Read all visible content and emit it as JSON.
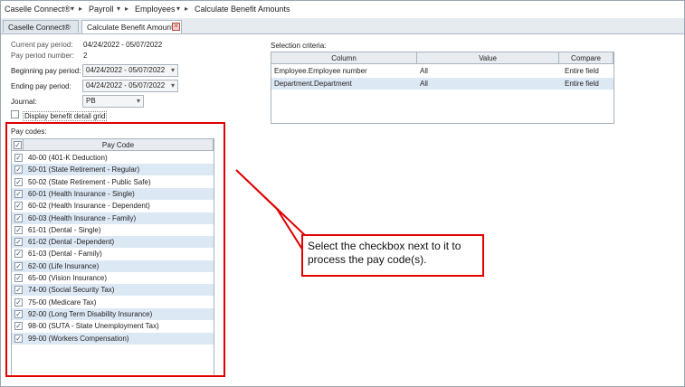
{
  "breadcrumb": [
    "Caselle Connect®",
    "Payroll",
    "Employees",
    "Calculate Benefit Amounts"
  ],
  "tabs": [
    {
      "label": "Caselle Connect®"
    },
    {
      "label": "Calculate Benefit Amounts"
    }
  ],
  "form": {
    "current_pay_period_label": "Current pay period:",
    "current_pay_period_value": "04/24/2022 - 05/07/2022",
    "pay_period_number_label": "Pay period number:",
    "pay_period_number_value": "2",
    "beginning_pay_period_label": "Beginning pay period:",
    "beginning_pay_period_value": "04/24/2022 - 05/07/2022",
    "ending_pay_period_label": "Ending pay period:",
    "ending_pay_period_value": "04/24/2022 - 05/07/2022",
    "journal_label": "Journal:",
    "journal_value": "PB",
    "display_detail_label": "Display benefit detail grid",
    "pay_codes_label": "Pay codes:"
  },
  "pay_codes": {
    "header": "Pay Code",
    "items": [
      "40-00 (401-K Deduction)",
      "50-01 (State Retirement - Regular)",
      "50-02 (State Retirement - Public Safe)",
      "60-01 (Health Insurance - Single)",
      "60-02 (Health Insurance - Dependent)",
      "60-03 (Health Insurance - Family)",
      "61-01 (Dental - Single)",
      "61-02 (Dental -Dependent)",
      "61-03 (Dental - Family)",
      "62-00 (Life Insurance)",
      "65-00 (Vision Insurance)",
      "74-00 (Social Security Tax)",
      "75-00 (Medicare Tax)",
      "92-00 (Long Term Disability Insurance)",
      "98-00 (SUTA - State Unemployment Tax)",
      "99-00 (Workers Compensation)"
    ]
  },
  "selection": {
    "label": "Selection criteria:",
    "columns": [
      "Column",
      "Value",
      "Compare"
    ],
    "rows": [
      [
        "Employee.Employee number",
        "All",
        "Entire field"
      ],
      [
        "Department.Department",
        "All",
        "Entire field"
      ]
    ]
  },
  "callout": {
    "text": "Select the checkbox next to it to process the pay code(s)."
  },
  "colors": {
    "highlight": "#e00000",
    "row_alt": "#dde8f5"
  }
}
